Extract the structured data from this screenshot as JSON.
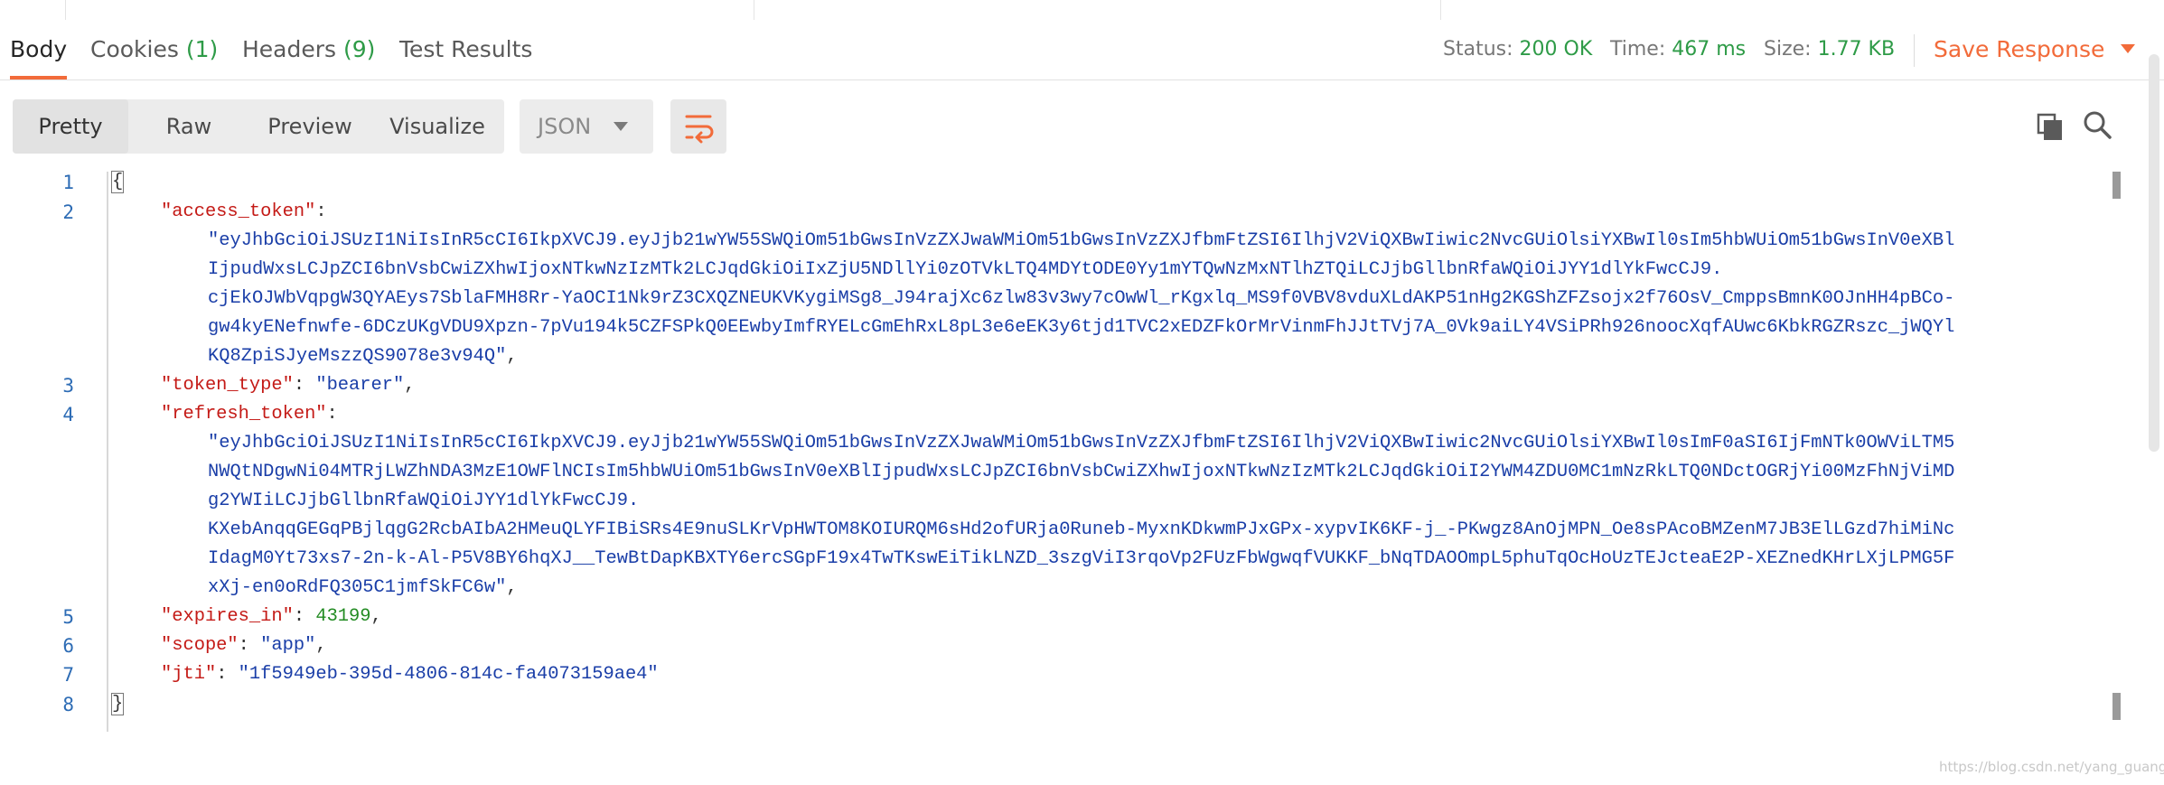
{
  "tabs": {
    "body": "Body",
    "cookies": "Cookies",
    "cookies_count": "(1)",
    "headers": "Headers",
    "headers_count": "(9)",
    "test_results": "Test Results"
  },
  "status": {
    "status_label": "Status:",
    "status_value": "200 OK",
    "time_label": "Time:",
    "time_value": "467 ms",
    "size_label": "Size:",
    "size_value": "1.77 KB"
  },
  "save_response": "Save Response",
  "view_modes": {
    "pretty": "Pretty",
    "raw": "Raw",
    "preview": "Preview",
    "visualize": "Visualize"
  },
  "format_select": {
    "selected": "JSON"
  },
  "icons": {
    "wrap": "wrap-lines-icon",
    "copy": "copy-icon",
    "search": "search-icon"
  },
  "colors": {
    "accent": "#f26b3a",
    "ok": "#2e9b47",
    "key": "#c41a16",
    "string": "#1a3ea8",
    "number": "#228b22",
    "line_number": "#2d6cb5"
  },
  "line_numbers": [
    "1",
    "2",
    "3",
    "4",
    "5",
    "6",
    "7",
    "8"
  ],
  "code": {
    "open_brace": "{",
    "close_brace": "}",
    "comma": ",",
    "colon": ": ",
    "access_token_key": "\"access_token\"",
    "access_token_lines": [
      "\"eyJhbGciOiJSUzI1NiIsInR5cCI6IkpXVCJ9.eyJjb21wYW55SWQiOm51bGwsInVzZXJwaWMiOm51bGwsInVzZXJfbmFtZSI6IlhjV2ViQXBwIiwic2NvcGUiOlsiYXBwIl0sIm5hbWUiOm51bGwsInV0eXBl",
      "IjpudWxsLCJpZCI6bnVsbCwiZXhwIjoxNTkwNzIzMTk2LCJqdGkiOiIxZjU5NDllYi0zOTVkLTQ4MDYtODE0Yy1mYTQwNzMxNTlhZTQiLCJjbGllbnRfaWQiOiJYY1dlYkFwcCJ9.",
      "cjEkOJWbVqpgW3QYAEys7SblaFMH8Rr-YaOCI1Nk9rZ3CXQZNEUKVKygiMSg8_J94rajXc6zlw83v3wy7cOwWl_rKgxlq_MS9f0VBV8vduXLdAKP51nHg2KGShZFZsojx2f76OsV_CmppsBmnK0OJnHH4pBCo-",
      "gw4kyENefnwfe-6DCzUKgVDU9Xpzn-7pVu194k5CZFSPkQ0EEwbyImfRYELcGmEhRxL8pL3e6eEK3y6tjd1TVC2xEDZFkOrMrVinmFhJJtTVj7A_0Vk9aiLY4VSiPRh926noocXqfAUwc6KbkRGZRszc_jWQYl",
      "KQ8ZpiSJyeMszzQS9078e3v94Q\""
    ],
    "token_type_key": "\"token_type\"",
    "token_type_value": "\"bearer\"",
    "refresh_token_key": "\"refresh_token\"",
    "refresh_token_lines": [
      "\"eyJhbGciOiJSUzI1NiIsInR5cCI6IkpXVCJ9.eyJjb21wYW55SWQiOm51bGwsInVzZXJwaWMiOm51bGwsInVzZXJfbmFtZSI6IlhjV2ViQXBwIiwic2NvcGUiOlsiYXBwIl0sImF0aSI6IjFmNTk0OWViLTM5",
      "NWQtNDgwNi04MTRjLWZhNDA3MzE1OWFlNCIsIm5hbWUiOm51bGwsInV0eXBlIjpudWxsLCJpZCI6bnVsbCwiZXhwIjoxNTkwNzIzMTk2LCJqdGkiOiI2YWM4ZDU0MC1mNzRkLTQ0NDctOGRjYi00MzFhNjViMD",
      "g2YWIiLCJjbGllbnRfaWQiOiJYY1dlYkFwcCJ9.",
      "KXebAnqqGEGqPBjlqgG2RcbAIbA2HMeuQLYFIBiSRs4E9nuSLKrVpHWTOM8KOIURQM6sHd2ofURja0Runeb-MyxnKDkwmPJxGPx-xypvIK6KF-j_-PKwgz8AnOjMPN_Oe8sPAcoBMZenM7JB3ElLGzd7hiMiNc",
      "IdagM0Yt73xs7-2n-k-Al-P5V8BY6hqXJ__TewBtDapKBXTY6ercSGpF19x4TwTKswEiTikLNZD_3szgViI3rqoVp2FUzFbWgwqfVUKKF_bNqTDAOOmpL5phuTqOcHoUzTEJcteaE2P-XEZnedKHrLXjLPMG5F",
      "xXj-en0oRdFQ305C1jmfSkFC6w\""
    ],
    "expires_in_key": "\"expires_in\"",
    "expires_in_value": "43199",
    "scope_key": "\"scope\"",
    "scope_value": "\"app\"",
    "jti_key": "\"jti\"",
    "jti_value": "\"1f5949eb-395d-4806-814c-fa4073159ae4\""
  },
  "watermark": "https://blog.csdn.net/yang_guang3"
}
